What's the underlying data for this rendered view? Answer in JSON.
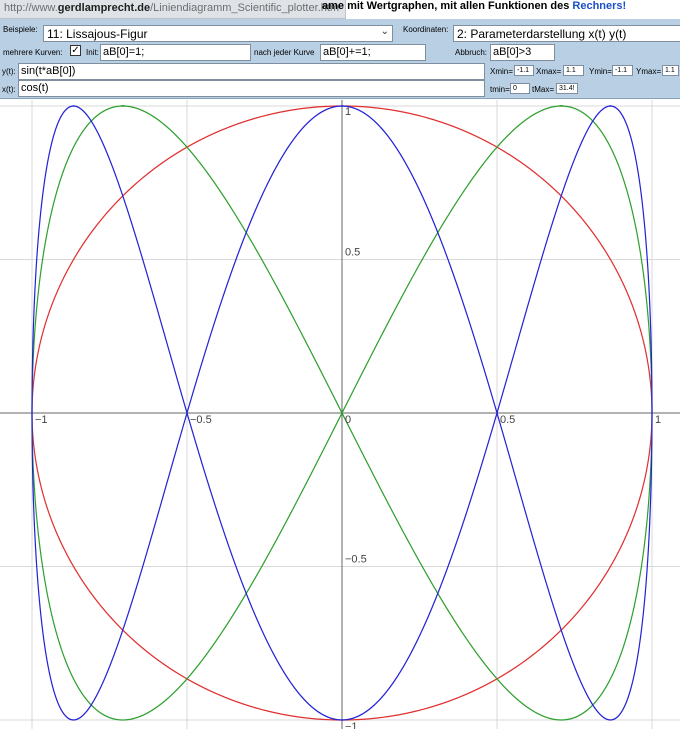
{
  "url_bar": {
    "prefix": "http://www.",
    "host": "gerdlamprecht.de",
    "path": "/Liniendiagramm_Scientific_plotter.htm"
  },
  "header_cut_text": {
    "text": "ame mit Wertgraphen, mit allen Funktionen des ",
    "link": "Rechners!"
  },
  "controls": {
    "beispiele_label": "Beispiele:",
    "beispiele_value": "11: Lissajous-Figur",
    "koordinaten_label": "Koordinaten:",
    "koordinaten_value": "2: Parameterdarstellung x(t) y(t)",
    "mehrere_label": "mehrere Kurven:",
    "mehrere_checked": "✓",
    "init_label": "Init:",
    "init_value": "aB[0]=1;",
    "nach_label": "nach jeder Kurve",
    "nach_value": "aB[0]+=1;",
    "abbruch_label": "Abbruch:",
    "abbruch_value": "aB[0]>3",
    "yt_label": "y(t):",
    "yt_value": "sin(t*aB[0])",
    "xt_label": "x(t):",
    "xt_value": "cos(t)",
    "xmin_label": "Xmin=",
    "xmin_value": "-1.1",
    "xmax_label": "Xmax=",
    "xmax_value": "1.1",
    "ymin_label": "Ymin=",
    "ymin_value": "-1.1",
    "ymax_label": "Ymax=",
    "ymax_value": "1.1",
    "tmin_label": "tmin=",
    "tmin_value": "0",
    "tmax_label": "tMax=",
    "tmax_value": "31.4!"
  },
  "chart_data": {
    "type": "line",
    "xlim": [
      -1.1,
      1.1
    ],
    "ylim": [
      -1.0,
      1.0
    ],
    "grid": true,
    "x_ticks": [
      "−1",
      "−0.5",
      "0",
      "0.5",
      "1"
    ],
    "y_ticks": [
      "1",
      "0.5",
      "−0.5",
      "−1"
    ],
    "t_range": [
      0,
      31.4
    ],
    "series": [
      {
        "x_expr": "cos(t)",
        "y_expr": "sin(t*1)",
        "color": "#e03030"
      },
      {
        "x_expr": "cos(t)",
        "y_expr": "sin(t*2)",
        "color": "#2ea02e"
      },
      {
        "x_expr": "cos(t)",
        "y_expr": "sin(t*3)",
        "color": "#2323d6"
      }
    ]
  }
}
